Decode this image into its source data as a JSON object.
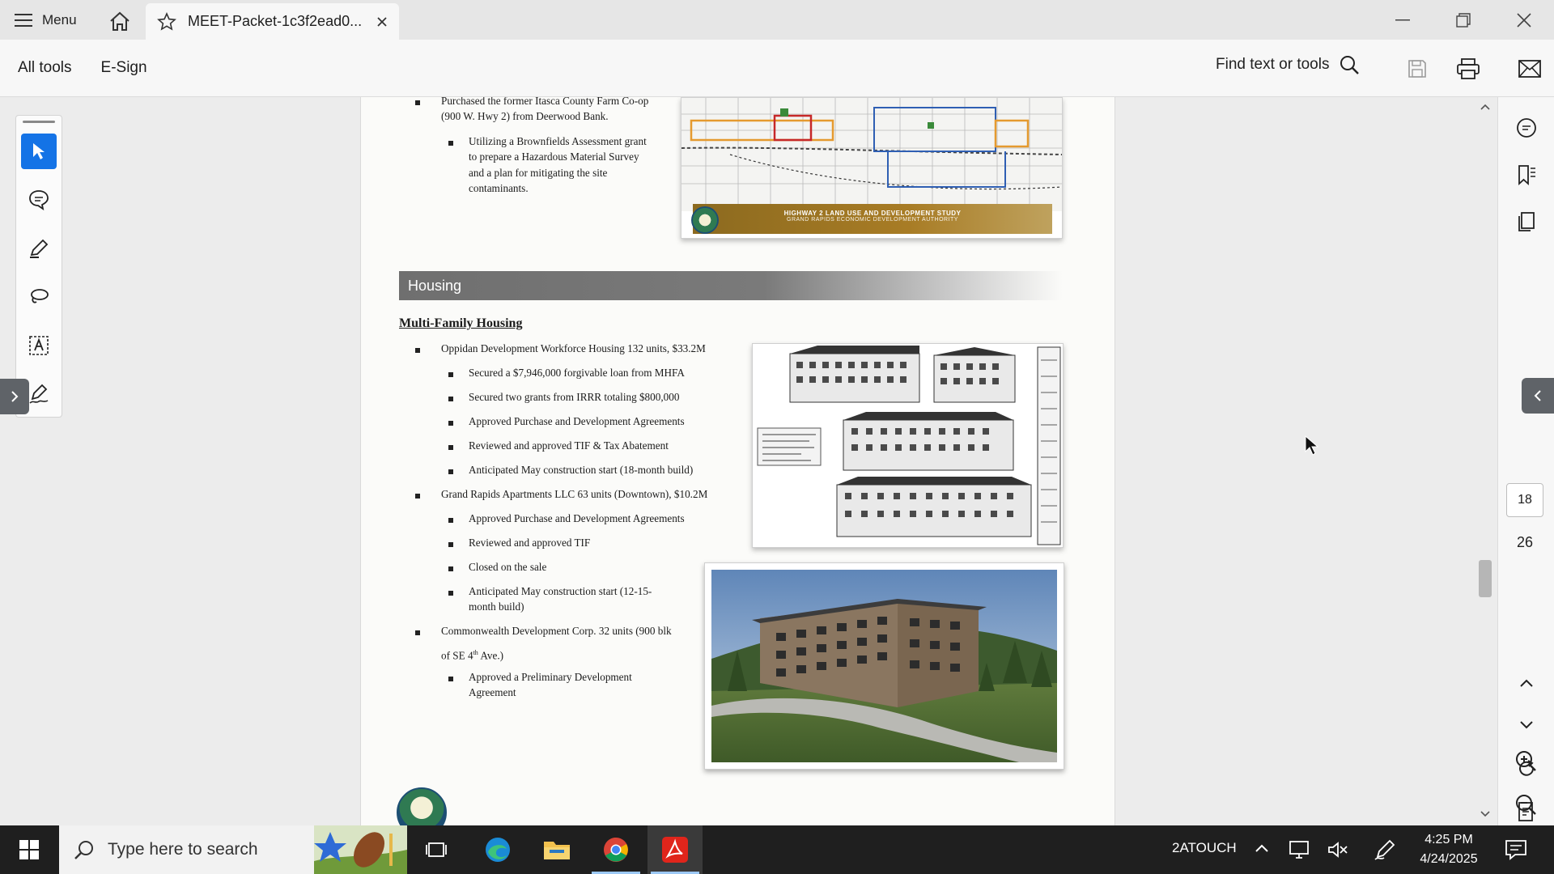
{
  "titlebar": {
    "menu_label": "Menu",
    "tab_title": "MEET-Packet-1c3f2ead0..."
  },
  "toolbar": {
    "all_tools": "All tools",
    "esign": "E-Sign",
    "find_label": "Find text or tools"
  },
  "document": {
    "intro_bullet": [
      "Purchased the former Itasca County Farm Co-op",
      "(900 W. Hwy 2) from Deerwood Bank."
    ],
    "intro_sub": [
      "Utilizing a Brownfields Assessment grant",
      "to prepare a Hazardous Material Survey",
      "and a plan for mitigating the site",
      "contaminants."
    ],
    "map_banner_title": "HIGHWAY 2 LAND USE AND DEVELOPMENT STUDY",
    "map_banner_sub": "GRAND RAPIDS ECONOMIC DEVELOPMENT AUTHORITY",
    "section_title": "Housing",
    "subheading": "Multi-Family Housing",
    "project1": "Oppidan Development Workforce Housing 132 units, $33.2M",
    "project1_items": [
      "Secured a $7,946,000 forgivable loan from MHFA",
      "Secured two grants from IRRR totaling $800,000",
      "Approved Purchase and Development Agreements",
      "Reviewed and approved TIF & Tax Abatement",
      "Anticipated May construction start (18-month build)"
    ],
    "project2": "Grand Rapids Apartments LLC 63 units (Downtown), $10.2M",
    "project2_items": [
      "Approved Purchase and Development Agreements",
      "Reviewed and approved TIF",
      "Closed on the sale"
    ],
    "project2_last": [
      "Anticipated May construction start (12-15-",
      "month build)"
    ],
    "project3_line1": "Commonwealth Development Corp. 32 units (900 blk",
    "project3_line2": "of SE 4",
    "project3_sup": "th",
    "project3_line2b": " Ave.)",
    "project3_items": [
      "Approved a Preliminary Development",
      "Agreement"
    ]
  },
  "navigation": {
    "current_page": "18",
    "total_pages": "26"
  },
  "taskbar": {
    "search_placeholder": "Type here to search",
    "tray_label": "2ATOUCH",
    "time": "4:25 PM",
    "date": "4/24/2025"
  },
  "colors": {
    "accent": "#1473e6",
    "section_bar": "#6f6f6f",
    "map_banner": "#a87c25",
    "taskbar": "#1f1f1f"
  }
}
